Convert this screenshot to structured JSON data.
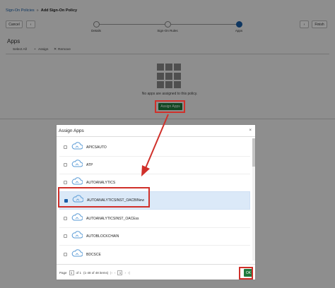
{
  "breadcrumb": {
    "parent": "Sign-On Policies",
    "separator": "»",
    "current": "Add Sign-On Policy"
  },
  "toolbar": {
    "cancel_label": "Cancel",
    "back_label": "‹",
    "next_label": "›",
    "finish_label": "Finish"
  },
  "train": {
    "steps": [
      "Details",
      "Sign-On Rules",
      "Apps"
    ],
    "active_index": 2
  },
  "apps_section": {
    "title": "Apps",
    "select_all_label": "Select All",
    "assign_label": "Assign",
    "remove_label": "Remove",
    "empty_message": "No apps are assigned to this policy.",
    "assign_apps_button": "Assign Apps"
  },
  "modal": {
    "title": "Assign Apps",
    "close_label": "×",
    "items": [
      {
        "name": "APICSAUTO",
        "selected": false
      },
      {
        "name": "ATP",
        "selected": false
      },
      {
        "name": "AUTOANALYTICS",
        "selected": false
      },
      {
        "name": "AUTOANALYTICSINST_OACBINew",
        "selected": true
      },
      {
        "name": "AUTOANALYTICSINST_OACEss",
        "selected": false
      },
      {
        "name": "AUTOBLOCKCHAIN",
        "selected": false
      },
      {
        "name": "BDCSCE",
        "selected": false
      }
    ],
    "pager": {
      "page_label": "Page",
      "page_value": "1",
      "of_label": "of 1",
      "range": "(1-48 of 48 items)",
      "current_page": "1"
    },
    "ok_label": "OK"
  },
  "colors": {
    "accent_blue": "#1a5fa8",
    "button_green": "#1e7a3c",
    "highlight_red": "#d0302a"
  }
}
